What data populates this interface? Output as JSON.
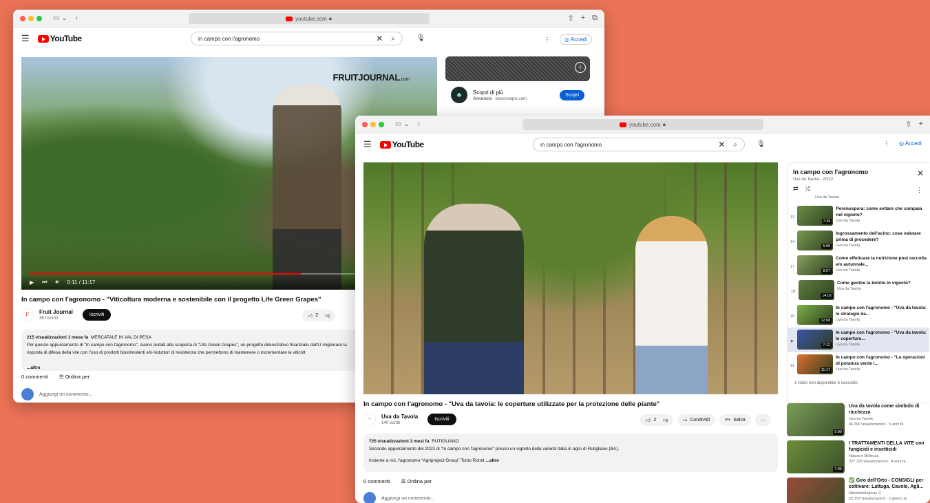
{
  "window1": {
    "url": "youtube.com",
    "search_value": "in campo con l'agronomo",
    "login_label": "Accedi",
    "video_overlay_logo": "FRUITJOURNAL",
    "video_overlay_logo_suffix": ".com",
    "time_label": "0:11 / 11:17",
    "title": "In campo con l'agronomo - \"Viticoltura moderna e sostenibile con il progetto Life Green Grapes\"",
    "channel_name": "Fruit Journal",
    "channel_subs": "367 iscritti",
    "subscribe_label": "Iscriviti",
    "like_count": "2",
    "desc_stats": "215 visualizzazioni  1 mese fa",
    "desc_location": "MERCATALE IN VAL DI PESA",
    "desc_text": "Per questo appuntamento di \"In campo con l'agronomo\", siamo andati alla scoperta di \"Life Green Grapes\", un progetto dimostrativo finanziato dall'U migliorare la risposta di difesa della vite con l'uso di prodotti biostimolanti e/o induttori di resistenza che permettono di mantenere o incrementare la viticolt",
    "desc_more": "...altro",
    "comments_count": "0 commenti",
    "sort_label": "Ordina per",
    "add_comment": "Aggiungi un commento...",
    "ad_title": "Scopri di più",
    "ad_sub_bold": "Annuncio",
    "ad_sub": "· bioconcepts.com",
    "ad_button": "Scopri"
  },
  "window2": {
    "url": "youtube.com",
    "search_value": "in campo con l'agronomo",
    "login_label": "Accedi",
    "title": "In campo con l'agronomo - \"Uva da tavola: le coperture utilizzate per la protezione delle piante\"",
    "channel_name": "Uva da Tavola",
    "channel_subs": "140 iscritti",
    "subscribe_label": "Iscriviti",
    "like_count": "2",
    "share_label": "Condividi",
    "save_label": "Salva",
    "desc_stats": "725 visualizzazioni  3 mesi fa",
    "desc_location": "RUTIGLIANO",
    "desc_line1": "Secondo appuntamento del 2023 di \"In campo con l'agronomo\" presso un vigneto della varietà Italia in agro di Rutigliano (BA).",
    "desc_line2": "Insieme a noi, l'agronomo \"Agriproject Group\" Tonio Romit",
    "desc_more": "...altro",
    "comments_count": "0 commenti",
    "sort_label": "Ordina per",
    "add_comment": "Aggiungi un commento...",
    "playlist": {
      "title": "In campo con l'agronomo",
      "sub": "Uva da Tavola - 20/22",
      "partial_top": "Uva da Tavola",
      "items": [
        {
          "idx": "13",
          "title": "Peronospora: come evitare che compaia nel vigneto?",
          "channel": "Uva da Tavola",
          "duration": "7:39",
          "thumb": "#6c8d4a"
        },
        {
          "idx": "14",
          "title": "Ingrossamento dell'acino: cosa valutare prima di procedere?",
          "channel": "Uva da Tavola",
          "duration": "5:59",
          "thumb": "#7a9a52"
        },
        {
          "idx": "17",
          "title": "Come effettuare la nutrizione post raccolta e/o autunnale...",
          "channel": "Uva da Tavola",
          "duration": "8:57",
          "thumb": "#8aa060"
        },
        {
          "idx": "18",
          "title": "Come gestire la botrite in vigneto?",
          "channel": "Uva da Tavola",
          "duration": "14:02",
          "thumb": "#5f7f40"
        },
        {
          "idx": "19",
          "title": "In campo con l'agronomo - \"Uva da tavola: le strategie da...",
          "channel": "Uva da Tavola",
          "duration": "12:08",
          "thumb": "#7bb04a"
        },
        {
          "idx": "▶",
          "title": "In campo con l'agronomo - \"Uva da tavola: le coperture...",
          "channel": "Uva da Tavola",
          "duration": "7:12",
          "thumb": "#3a55a8",
          "active": true
        },
        {
          "idx": "21",
          "title": "In campo con l'agronomo - \"Le operazioni di potatura verde i...",
          "channel": "Uva da Tavola",
          "duration": "11:17",
          "thumb": "#e07030"
        }
      ],
      "unavailable": "1 video non disponibile è nascosto"
    },
    "recommended": [
      {
        "title": "Uva da tavola come simbolo di ricchezza",
        "channel": "Uva da Tavola",
        "meta": "46 390 visualizzazioni · 5 anni fa",
        "duration": "5:00",
        "thumb": "#7a9e58"
      },
      {
        "title": "I TRATTAMENTI DELLA VITE con fungicidi e insetticidi",
        "channel": "Natura è Bellezza",
        "meta": "227 726 visualizzazioni · 4 anni fa",
        "duration": "7:05",
        "thumb": "#6b8f3a"
      },
      {
        "title": "✅ Giro dell'Orto - CONSIGLI per coltivare: Lattuga, Cavolo, Agli...",
        "channel": "Mirodebiologicas ⊙",
        "meta": "23 153 visualizzazioni · 1 giorno fa",
        "duration": "",
        "thumb": "#9a4a3a"
      }
    ]
  }
}
